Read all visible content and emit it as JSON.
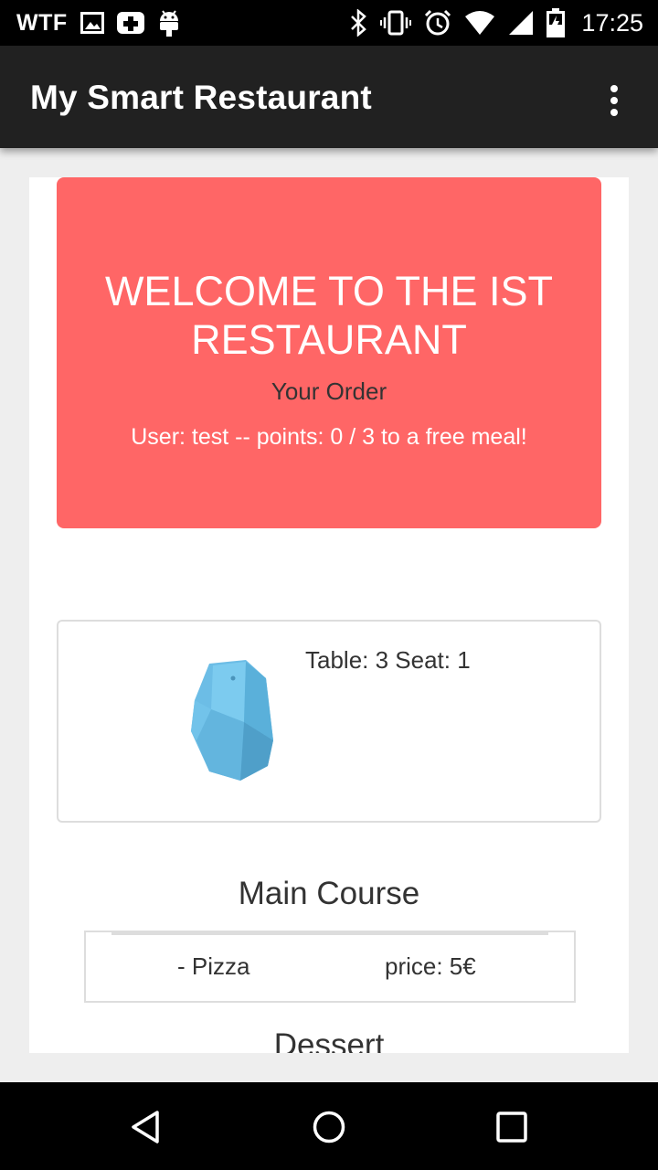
{
  "status_bar": {
    "carrier": "WTF",
    "time": "17:25",
    "icons": [
      "image-icon",
      "medical-plus-icon",
      "android-icon",
      "bluetooth-icon",
      "vibrate-icon",
      "alarm-icon",
      "wifi-icon",
      "signal-icon",
      "battery-charging-icon"
    ]
  },
  "app_bar": {
    "title": "My Smart Restaurant",
    "overflow_icon": "more-vert-icon"
  },
  "welcome": {
    "title": "WELCOME TO THE IST RESTAURANT",
    "subtitle": "Your Order",
    "user_info": "User: test -- points: 0 / 3 to a free meal!",
    "background_color": "#ff6666"
  },
  "table_info": {
    "text": "Table: 3 Seat: 1",
    "icon": "beacon-icon"
  },
  "order": {
    "main_course_title": "Main Course",
    "items": [
      {
        "name": "- Pizza",
        "price": "price: 5€"
      }
    ],
    "dessert_title": "Dessert"
  },
  "nav_bar": {
    "buttons": [
      "back-icon",
      "home-icon",
      "recents-icon"
    ]
  }
}
